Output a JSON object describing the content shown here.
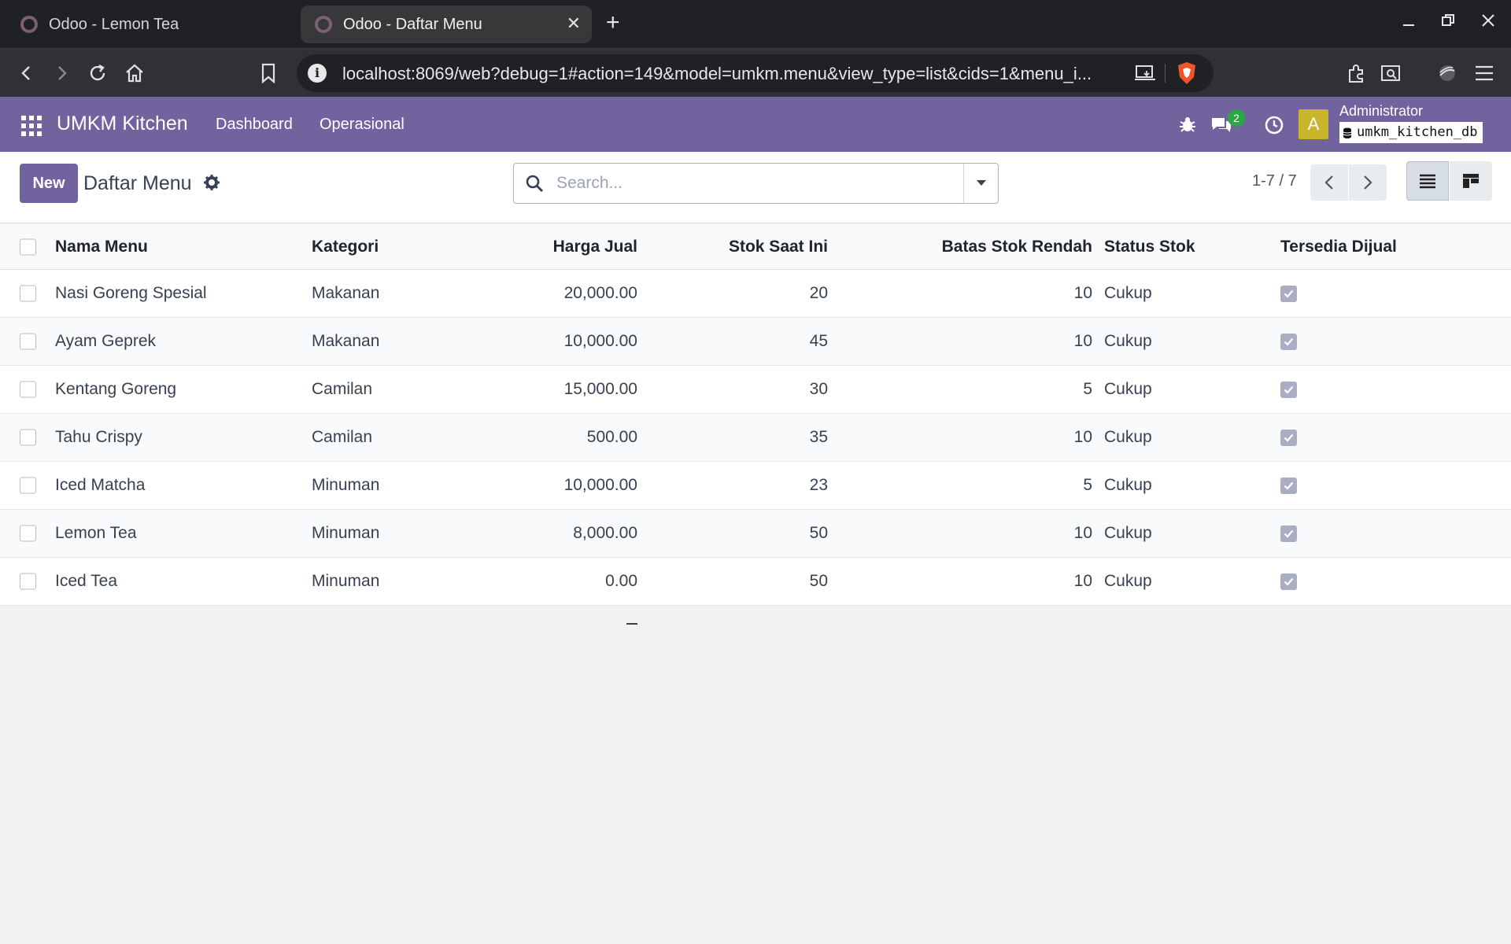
{
  "browser": {
    "tabs": [
      {
        "title": "Odoo - Lemon Tea",
        "active": false
      },
      {
        "title": "Odoo - Daftar Menu",
        "active": true
      }
    ],
    "url": "localhost:8069/web?debug=1#action=149&model=umkm.menu&view_type=list&cids=1&menu_i..."
  },
  "topbar": {
    "brand": "UMKM Kitchen",
    "menus": [
      "Dashboard",
      "Operasional"
    ],
    "chat_count": "2",
    "avatar_letter": "A",
    "user_name": "Administrator",
    "db_name": "umkm_kitchen_db",
    "color": "#71639e"
  },
  "control": {
    "new_label": "New",
    "title": "Daftar Menu",
    "search_placeholder": "Search...",
    "pager": "1-7 / 7"
  },
  "table": {
    "columns": [
      "Nama Menu",
      "Kategori",
      "Harga Jual",
      "Stok Saat Ini",
      "Batas Stok Rendah",
      "Status Stok",
      "Tersedia Dijual"
    ],
    "rows": [
      {
        "name": "Nasi Goreng Spesial",
        "kategori": "Makanan",
        "harga": "20,000.00",
        "stok": "20",
        "batas": "10",
        "status": "Cukup",
        "tersedia": true
      },
      {
        "name": "Ayam Geprek",
        "kategori": "Makanan",
        "harga": "10,000.00",
        "stok": "45",
        "batas": "10",
        "status": "Cukup",
        "tersedia": true
      },
      {
        "name": "Kentang Goreng",
        "kategori": "Camilan",
        "harga": "15,000.00",
        "stok": "30",
        "batas": "5",
        "status": "Cukup",
        "tersedia": true
      },
      {
        "name": "Tahu Crispy",
        "kategori": "Camilan",
        "harga": "500.00",
        "stok": "35",
        "batas": "10",
        "status": "Cukup",
        "tersedia": true
      },
      {
        "name": "Iced Matcha",
        "kategori": "Minuman",
        "harga": "10,000.00",
        "stok": "23",
        "batas": "5",
        "status": "Cukup",
        "tersedia": true
      },
      {
        "name": "Lemon Tea",
        "kategori": "Minuman",
        "harga": "8,000.00",
        "stok": "50",
        "batas": "10",
        "status": "Cukup",
        "tersedia": true
      },
      {
        "name": "Iced Tea",
        "kategori": "Minuman",
        "harga": "0.00",
        "stok": "50",
        "batas": "10",
        "status": "Cukup",
        "tersedia": true
      }
    ]
  }
}
